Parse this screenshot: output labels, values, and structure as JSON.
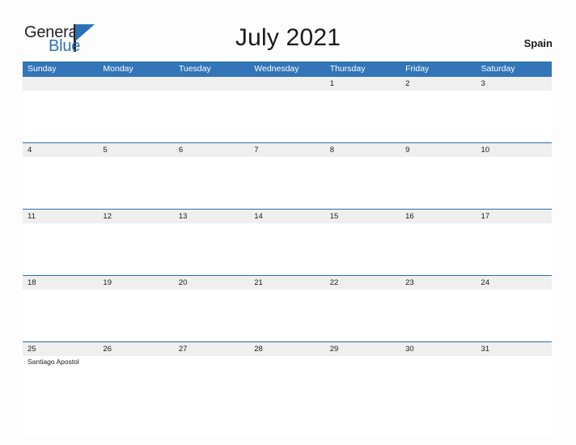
{
  "brand": {
    "name_part1": "General",
    "name_part2": "Blue",
    "triangle_icon": "triangle-icon",
    "accent_color": "#2a72b5"
  },
  "header": {
    "title": "July 2021",
    "country": "Spain"
  },
  "colors": {
    "header_blue": "#3275b8",
    "row_divider": "#2f6ea8",
    "date_band": "#efefef",
    "text": "#1a1a1a",
    "page_background": "#fdfdfd"
  },
  "calendar": {
    "weekday_headers": [
      "Sunday",
      "Monday",
      "Tuesday",
      "Wednesday",
      "Thursday",
      "Friday",
      "Saturday"
    ],
    "weeks": [
      {
        "days": [
          {
            "date": "",
            "events": []
          },
          {
            "date": "",
            "events": []
          },
          {
            "date": "",
            "events": []
          },
          {
            "date": "",
            "events": []
          },
          {
            "date": "1",
            "events": []
          },
          {
            "date": "2",
            "events": []
          },
          {
            "date": "3",
            "events": []
          }
        ]
      },
      {
        "days": [
          {
            "date": "4",
            "events": []
          },
          {
            "date": "5",
            "events": []
          },
          {
            "date": "6",
            "events": []
          },
          {
            "date": "7",
            "events": []
          },
          {
            "date": "8",
            "events": []
          },
          {
            "date": "9",
            "events": []
          },
          {
            "date": "10",
            "events": []
          }
        ]
      },
      {
        "days": [
          {
            "date": "11",
            "events": []
          },
          {
            "date": "12",
            "events": []
          },
          {
            "date": "13",
            "events": []
          },
          {
            "date": "14",
            "events": []
          },
          {
            "date": "15",
            "events": []
          },
          {
            "date": "16",
            "events": []
          },
          {
            "date": "17",
            "events": []
          }
        ]
      },
      {
        "days": [
          {
            "date": "18",
            "events": []
          },
          {
            "date": "19",
            "events": []
          },
          {
            "date": "20",
            "events": []
          },
          {
            "date": "21",
            "events": []
          },
          {
            "date": "22",
            "events": []
          },
          {
            "date": "23",
            "events": []
          },
          {
            "date": "24",
            "events": []
          }
        ]
      },
      {
        "days": [
          {
            "date": "25",
            "events": [
              "Santiago Apostol"
            ]
          },
          {
            "date": "26",
            "events": []
          },
          {
            "date": "27",
            "events": []
          },
          {
            "date": "28",
            "events": []
          },
          {
            "date": "29",
            "events": []
          },
          {
            "date": "30",
            "events": []
          },
          {
            "date": "31",
            "events": []
          }
        ]
      }
    ]
  }
}
